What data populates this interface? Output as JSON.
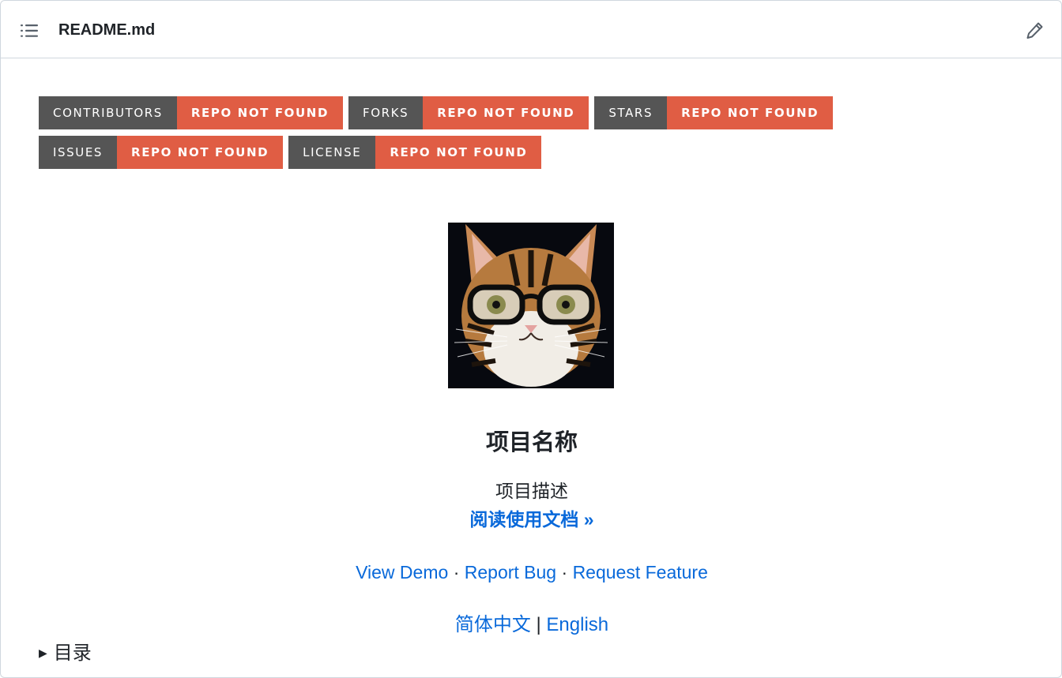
{
  "header": {
    "file_name": "README.md",
    "toc_icon": "list-unordered-icon",
    "edit_icon": "pencil-icon"
  },
  "badges": {
    "row1": [
      {
        "label": "CONTRIBUTORS",
        "message": "REPO NOT FOUND"
      },
      {
        "label": "FORKS",
        "message": "REPO NOT FOUND"
      },
      {
        "label": "STARS",
        "message": "REPO NOT FOUND"
      }
    ],
    "row2": [
      {
        "label": "ISSUES",
        "message": "REPO NOT FOUND"
      },
      {
        "label": "LICENSE",
        "message": "REPO NOT FOUND"
      }
    ],
    "colors": {
      "label_bg": "#555555",
      "message_bg": "#e05d44"
    }
  },
  "project": {
    "logo_icon": "cat-with-glasses-logo",
    "title": "项目名称",
    "description": "项目描述",
    "docs_link": "阅读使用文档 »"
  },
  "links": {
    "view_demo": "View Demo",
    "report_bug": "Report Bug",
    "request_feature": "Request Feature",
    "separator": "·"
  },
  "languages": {
    "chinese": "简体中文",
    "separator": "|",
    "english": "English"
  },
  "toc": {
    "marker": "▶",
    "summary": "目录"
  },
  "colors": {
    "link": "#0969da",
    "text": "#1f2328",
    "border": "#d0d7de"
  }
}
